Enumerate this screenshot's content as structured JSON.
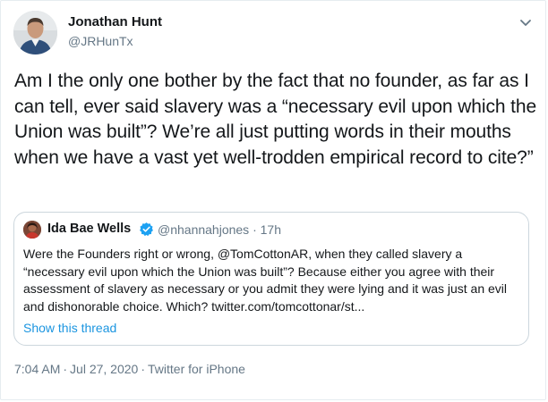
{
  "tweet": {
    "author_name": "Jonathan Hunt",
    "author_handle": "@JRHunTx",
    "text": "Am I the only one bother by the fact that no founder, as far as I can tell, ever said slavery was a “necessary evil upon which the Union was built”? We’re all just putting words in their mouths when we have a vast yet well-trodden empirical record to cite?”",
    "time": "7:04 AM",
    "date": "Jul 27, 2020",
    "separator": "·",
    "source": "Twitter for iPhone",
    "menu_icon": "chevron-down-icon"
  },
  "quoted_tweet": {
    "author_name": "Ida Bae Wells",
    "verified_icon": "verified-badge-icon",
    "author_handle": "@nhannahjones",
    "separator": "·",
    "age": "17h",
    "text": "Were the Founders right or wrong, @TomCottonAR, when they called slavery a “necessary evil upon which the Union was built”? Because either you agree with their assessment of slavery as necessary or you admit they were lying and it was just an evil and dishonorable choice. Which? twitter.com/tomcottonar/st...",
    "show_thread_label": "Show this thread"
  },
  "colors": {
    "text": "#14171a",
    "secondary": "#657786",
    "link": "#1b95e0",
    "border": "#ccd6dd",
    "verified": "#1da1f2"
  }
}
